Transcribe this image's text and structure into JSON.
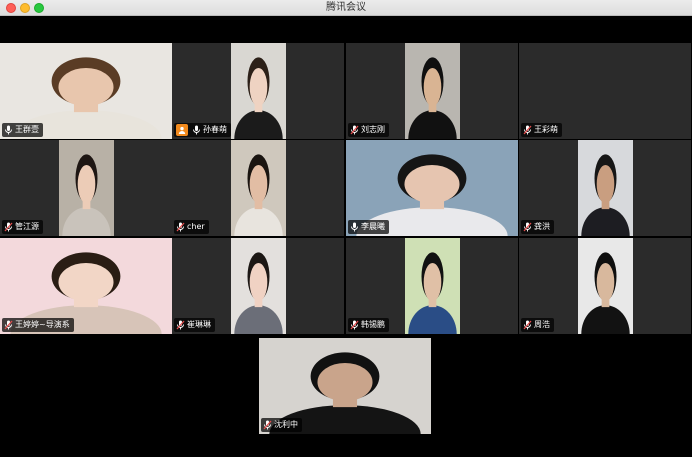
{
  "window": {
    "title": "腾讯会议"
  },
  "participants": [
    {
      "name": "王群壹",
      "mic": "on",
      "active": true,
      "bg": "#e9e6e1",
      "shirt": "#e8e4dc",
      "hair": "#5a3c25",
      "skin": "#e8c6ad"
    },
    {
      "name": "孙春萌",
      "mic": "on",
      "avatar_badge": true,
      "bg": "#d9d7d2",
      "shirt": "#1b1b1b",
      "hair": "#2c2018",
      "skin": "#efd3c2"
    },
    {
      "name": "刘志刚",
      "mic": "muted",
      "bg": "#b9b6b0",
      "shirt": "#111111",
      "hair": "#0f0f0f",
      "skin": "#d9b493"
    },
    {
      "name": "王彩萌",
      "mic": "muted",
      "video_off": true
    },
    {
      "name": "管江源",
      "mic": "muted",
      "bg": "#b8b1a6",
      "shirt": "#c9c3bb",
      "hair": "#1e1613",
      "skin": "#ecccb7"
    },
    {
      "name": "cher",
      "mic": "muted",
      "bg": "#cfc8bd",
      "shirt": "#e8e4de",
      "hair": "#1a1410",
      "skin": "#e2bda4"
    },
    {
      "name": "李晨曦",
      "mic": "on",
      "bg": "#8aa3b8",
      "shirt": "#e9e9ec",
      "hair": "#151515",
      "skin": "#e6c5b0"
    },
    {
      "name": "龚洪",
      "mic": "muted",
      "bg": "#d7d9dc",
      "shirt": "#1d1d22",
      "hair": "#161616",
      "skin": "#c99e80"
    },
    {
      "name": "王婷婷~导演系",
      "mic": "muted",
      "bg": "#f3d9dc",
      "shirt": "#d7c4b8",
      "hair": "#2a1d14",
      "skin": "#f2d6c6"
    },
    {
      "name": "崔琳琳",
      "mic": "muted",
      "bg": "#e3e0dd",
      "shirt": "#6b6e78",
      "hair": "#1c1714",
      "skin": "#f0d2c3"
    },
    {
      "name": "韩锡鹏",
      "mic": "muted",
      "bg": "#cfe0b5",
      "shirt": "#2a4d86",
      "hair": "#111111",
      "skin": "#e0c0a6"
    },
    {
      "name": "周浩",
      "mic": "muted",
      "bg": "#e8e8e8",
      "shirt": "#121212",
      "hair": "#0f0f0f",
      "skin": "#d8b89d"
    },
    {
      "name": "沈利中",
      "mic": "muted",
      "bg": "#d6d3cf",
      "shirt": "#141414",
      "hair": "#111111",
      "skin": "#c9a48b"
    }
  ],
  "colors": {
    "active_border": "#3dcb5b",
    "muted_mic": "#e34d4d",
    "avatar_badge": "#f28a1d"
  }
}
